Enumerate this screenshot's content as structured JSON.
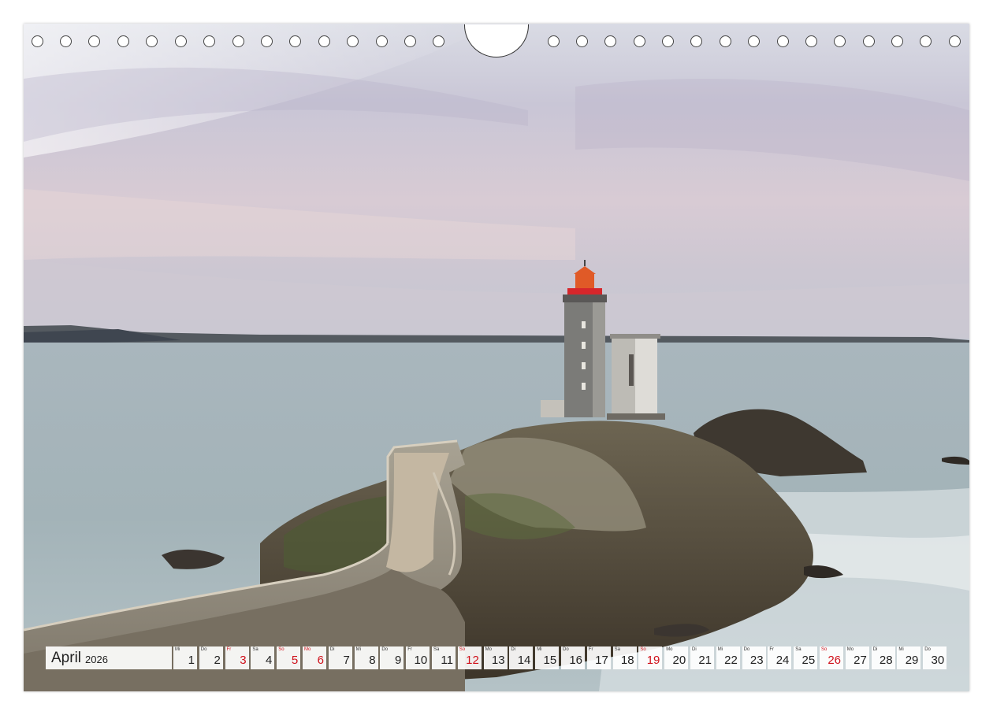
{
  "calendar": {
    "month": "April",
    "year": "2026",
    "days": [
      {
        "wd": "Mi",
        "d": "1",
        "red": false
      },
      {
        "wd": "Do",
        "d": "2",
        "red": false
      },
      {
        "wd": "Fr",
        "d": "3",
        "red": true
      },
      {
        "wd": "Sa",
        "d": "4",
        "red": false
      },
      {
        "wd": "So",
        "d": "5",
        "red": true
      },
      {
        "wd": "Mo",
        "d": "6",
        "red": true
      },
      {
        "wd": "Di",
        "d": "7",
        "red": false
      },
      {
        "wd": "Mi",
        "d": "8",
        "red": false
      },
      {
        "wd": "Do",
        "d": "9",
        "red": false
      },
      {
        "wd": "Fr",
        "d": "10",
        "red": false
      },
      {
        "wd": "Sa",
        "d": "11",
        "red": false
      },
      {
        "wd": "So",
        "d": "12",
        "red": true
      },
      {
        "wd": "Mo",
        "d": "13",
        "red": false
      },
      {
        "wd": "Di",
        "d": "14",
        "red": false
      },
      {
        "wd": "Mi",
        "d": "15",
        "red": false
      },
      {
        "wd": "Do",
        "d": "16",
        "red": false
      },
      {
        "wd": "Fr",
        "d": "17",
        "red": false
      },
      {
        "wd": "Sa",
        "d": "18",
        "red": false
      },
      {
        "wd": "So",
        "d": "19",
        "red": true
      },
      {
        "wd": "Mo",
        "d": "20",
        "red": false
      },
      {
        "wd": "Di",
        "d": "21",
        "red": false
      },
      {
        "wd": "Mi",
        "d": "22",
        "red": false
      },
      {
        "wd": "Do",
        "d": "23",
        "red": false
      },
      {
        "wd": "Fr",
        "d": "24",
        "red": false
      },
      {
        "wd": "Sa",
        "d": "25",
        "red": false
      },
      {
        "wd": "So",
        "d": "26",
        "red": true
      },
      {
        "wd": "Mo",
        "d": "27",
        "red": false
      },
      {
        "wd": "Di",
        "d": "28",
        "red": false
      },
      {
        "wd": "Mi",
        "d": "29",
        "red": false
      },
      {
        "wd": "Do",
        "d": "30",
        "red": false
      }
    ]
  },
  "colors": {
    "holiday_red": "#d0111b",
    "lantern_red": "#d6262b"
  },
  "icons": {
    "binding": "ring-hole-icon",
    "hanger": "hanger-cutout-icon"
  }
}
